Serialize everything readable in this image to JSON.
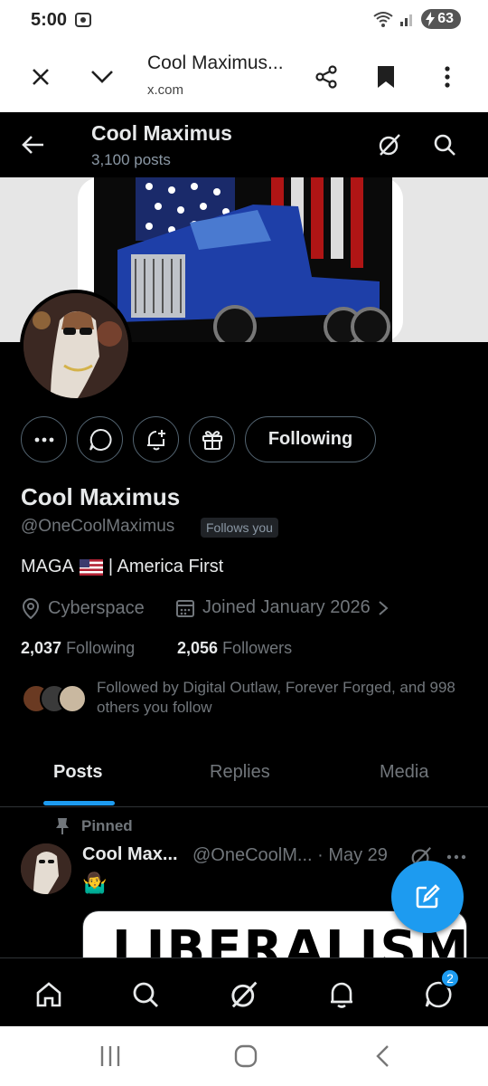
{
  "status_bar": {
    "time": "5:00",
    "battery": "63"
  },
  "browser": {
    "title": "Cool Maximus...",
    "url": "x.com"
  },
  "x_header": {
    "name": "Cool Maximus",
    "posts_count": "3,100 posts"
  },
  "banner": {
    "description_icon": "truck-flag-banner"
  },
  "actions": {
    "following_label": "Following"
  },
  "profile": {
    "name": "Cool Maximus",
    "handle": "@OneCoolMaximus",
    "follows_you": "Follows you",
    "bio_part1": "MAGA",
    "bio_part2": "| America First",
    "location": "Cyberspace",
    "joined": "Joined January 2026",
    "following_count": "2,037",
    "following_label": "Following",
    "followers_count": "2,056",
    "followers_label": "Followers",
    "followed_by": "Followed by Digital Outlaw, Forever Forged, and 998 others you follow"
  },
  "tabs": [
    {
      "label": "Posts"
    },
    {
      "label": "Replies"
    },
    {
      "label": "Media"
    }
  ],
  "post": {
    "pinned_label": "Pinned",
    "name": "Cool Max...",
    "handle_date": "@OneCoolM... · May 29",
    "emoji": "🤷‍♂️",
    "media_text": "LIBERALISM"
  },
  "bottom_nav": {
    "messages_badge": "2"
  },
  "colors": {
    "accent": "#1d9bf0",
    "background": "#000000",
    "muted": "#71767b"
  }
}
